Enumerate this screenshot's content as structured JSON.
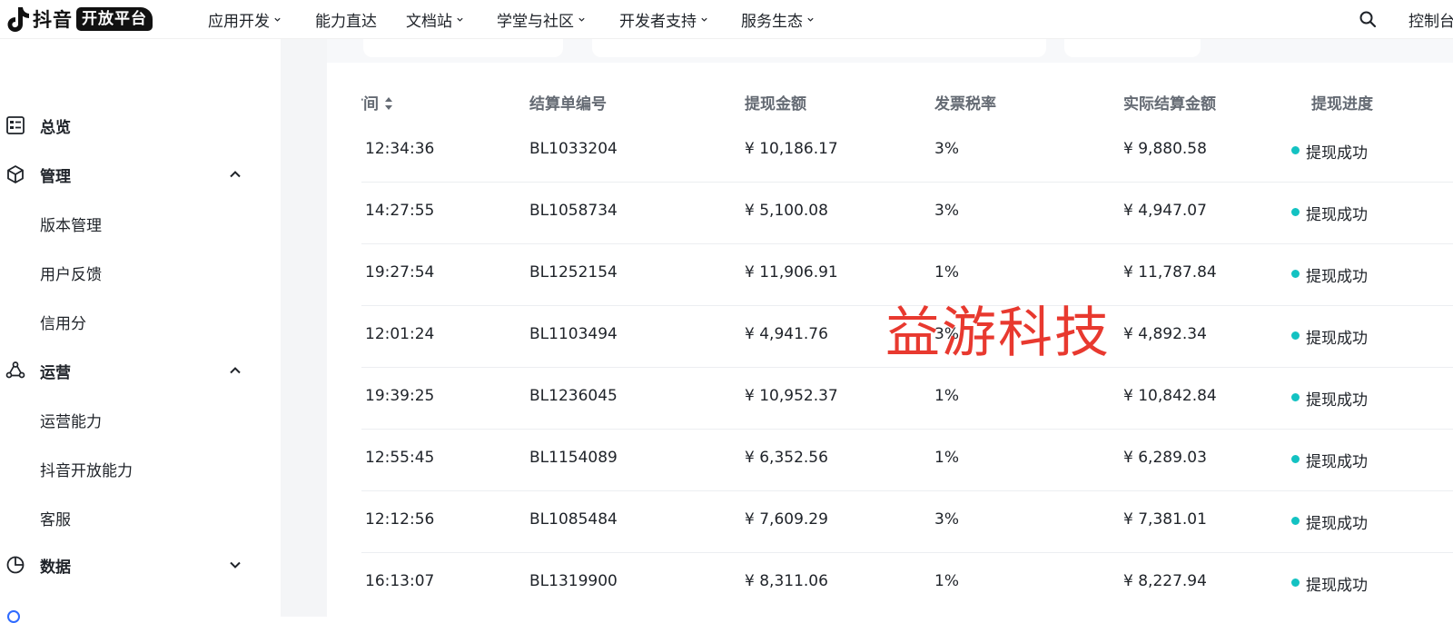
{
  "header": {
    "logo_text": "抖音",
    "logo_badge": "开放平台",
    "nav": [
      "应用开发",
      "能力直达",
      "文档站",
      "学堂与社区",
      "开发者支持",
      "服务生态"
    ],
    "console": "控制台"
  },
  "sidebar": {
    "overview": "总览",
    "manage": "管理",
    "manage_items": [
      "版本管理",
      "用户反馈",
      "信用分"
    ],
    "operate": "运营",
    "operate_items": [
      "运营能力",
      "抖音开放能力",
      "客服"
    ],
    "data": "数据"
  },
  "table": {
    "headers": [
      "时间",
      "结算单编号",
      "提现金额",
      "发票税率",
      "实际结算金额",
      "提现进度"
    ],
    "rows": [
      {
        "time": "12:34:36",
        "id": "BL1033204",
        "amount": "¥ 10,186.17",
        "rate": "3%",
        "actual": "¥ 9,880.58",
        "status": "提现成功"
      },
      {
        "time": "14:27:55",
        "id": "BL1058734",
        "amount": "¥ 5,100.08",
        "rate": "3%",
        "actual": "¥ 4,947.07",
        "status": "提现成功"
      },
      {
        "time": "19:27:54",
        "id": "BL1252154",
        "amount": "¥ 11,906.91",
        "rate": "1%",
        "actual": "¥ 11,787.84",
        "status": "提现成功"
      },
      {
        "time": "12:01:24",
        "id": "BL1103494",
        "amount": "¥ 4,941.76",
        "rate": "3%",
        "actual": "¥ 4,892.34",
        "status": "提现成功"
      },
      {
        "time": "19:39:25",
        "id": "BL1236045",
        "amount": "¥ 10,952.37",
        "rate": "1%",
        "actual": "¥ 10,842.84",
        "status": "提现成功"
      },
      {
        "time": "12:55:45",
        "id": "BL1154089",
        "amount": "¥ 6,352.56",
        "rate": "1%",
        "actual": "¥ 6,289.03",
        "status": "提现成功"
      },
      {
        "time": "12:12:56",
        "id": "BL1085484",
        "amount": "¥ 7,609.29",
        "rate": "3%",
        "actual": "¥ 7,381.01",
        "status": "提现成功"
      },
      {
        "time": "16:13:07",
        "id": "BL1319900",
        "amount": "¥ 8,311.06",
        "rate": "1%",
        "actual": "¥ 8,227.94",
        "status": "提现成功"
      }
    ]
  },
  "watermark": "益游科技",
  "colors": {
    "status_dot": "#13c2c2",
    "watermark": "#e8392f"
  }
}
